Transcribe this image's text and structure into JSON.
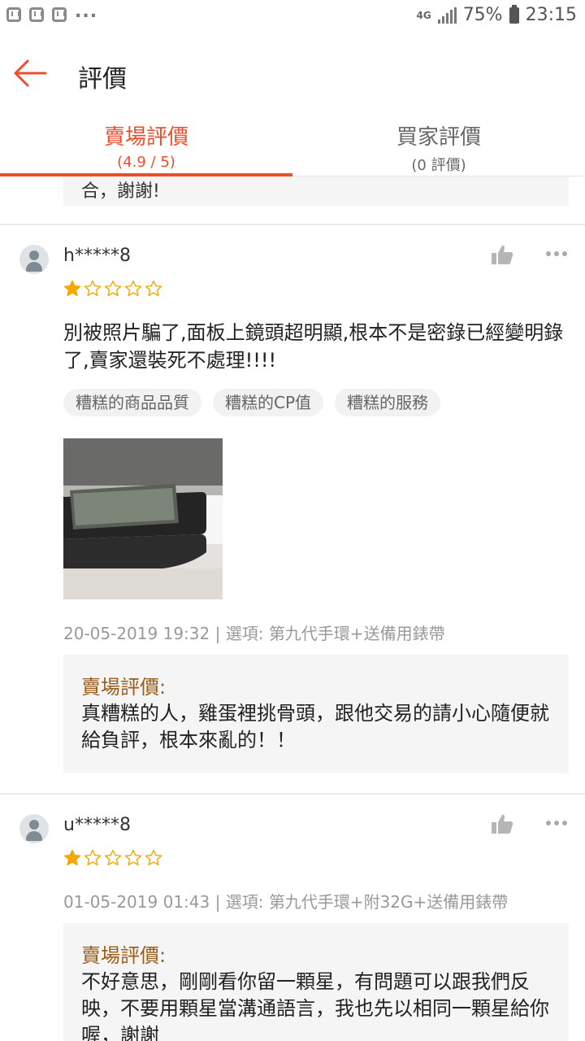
{
  "status_bar": {
    "network": "4G",
    "battery": "75%",
    "time": "23:15",
    "overflow": "..."
  },
  "header": {
    "title": "評價"
  },
  "tabs": [
    {
      "label": "賣場評價",
      "sub": "(4.9 / 5)",
      "active": true
    },
    {
      "label": "買家評價",
      "sub": "(0 評價)",
      "active": false
    }
  ],
  "previous_reply_fragment": "合，謝謝!",
  "reviews": [
    {
      "username": "h*****8",
      "rating": 1,
      "max_rating": 5,
      "text": "別被照片騙了,面板上鏡頭超明顯,根本不是密錄已經變明錄了,賣家還裝死不處理!!!!",
      "tags": [
        "糟糕的商品品質",
        "糟糕的CP值",
        "糟糕的服務"
      ],
      "date": "20-05-2019 19:32",
      "option_label": "選項:",
      "option": "第九代手環+送備用錶帶",
      "seller_reply_title": "賣場評價:",
      "seller_reply": "真糟糕的人，雞蛋裡挑骨頭，跟他交易的請小心隨便就給負評，根本來亂的！！"
    },
    {
      "username": "u*****8",
      "rating": 1,
      "max_rating": 5,
      "date": "01-05-2019 01:43",
      "option_label": "選項:",
      "option": "第九代手環+附32G+送備用錶帶",
      "seller_reply_title": "賣場評價:",
      "seller_reply": "不好意思，剛剛看你留一顆星，有問題可以跟我們反映，不要用顆星當溝通語言，我也先以相同一顆星給你喔，謝謝"
    }
  ],
  "colors": {
    "accent": "#ee4d2d",
    "star": "#f6a700",
    "reply_title": "#9a5c1a"
  }
}
